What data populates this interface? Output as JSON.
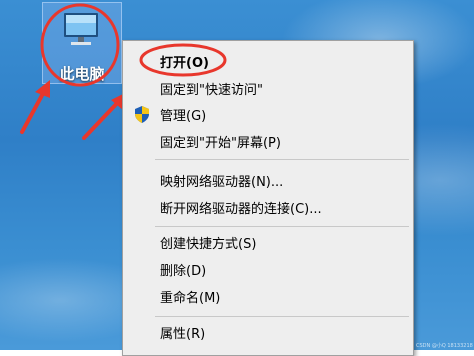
{
  "desktop": {
    "icon_label": "此电脑",
    "icon_name": "computer-icon",
    "wallpaper_color": "#3a8ed1"
  },
  "context_menu": {
    "items": [
      {
        "label": "打开(O)",
        "bold": true
      },
      {
        "label": "固定到\"快速访问\""
      },
      {
        "label": "管理(G)",
        "icon": "shield-icon"
      },
      {
        "label": "固定到\"开始\"屏幕(P)"
      },
      {
        "label": "映射网络驱动器(N)..."
      },
      {
        "label": "断开网络驱动器的连接(C)..."
      },
      {
        "label": "创建快捷方式(S)"
      },
      {
        "label": "删除(D)"
      },
      {
        "label": "重命名(M)"
      },
      {
        "label": "属性(R)"
      }
    ]
  },
  "annotations": {
    "color": "#e8372c"
  },
  "watermark": "CSDN @小Q 18133218"
}
